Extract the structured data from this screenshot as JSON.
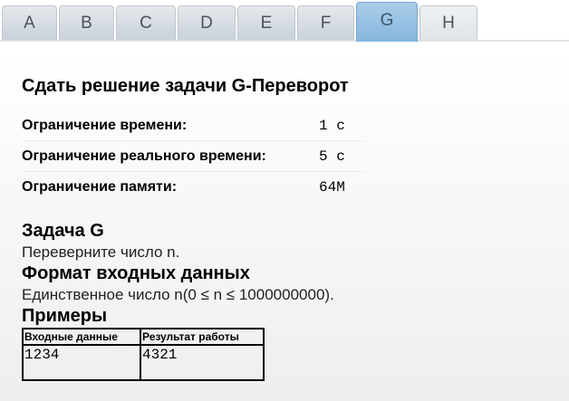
{
  "tabs": [
    {
      "label": "A",
      "active": false
    },
    {
      "label": "B",
      "active": false
    },
    {
      "label": "C",
      "active": false
    },
    {
      "label": "D",
      "active": false
    },
    {
      "label": "E",
      "active": false
    },
    {
      "label": "F",
      "active": false
    },
    {
      "label": "G",
      "active": true
    },
    {
      "label": "H",
      "active": false
    }
  ],
  "page_title": "Сдать решение задачи G-Переворот",
  "limits": [
    {
      "label": "Ограничение времени:",
      "value": "1 с"
    },
    {
      "label": "Ограничение реального времени:",
      "value": "5 с"
    },
    {
      "label": "Ограничение памяти:",
      "value": "64M"
    }
  ],
  "problem": {
    "heading": "Задача G",
    "statement": "Переверните число n.",
    "input_heading": "Формат входных данных",
    "input_text": "Единственное число n(0 ≤ n ≤ 1000000000).",
    "examples_heading": "Примеры",
    "examples_table": {
      "headers": [
        "Входные данные",
        "Результат работы"
      ],
      "rows": [
        [
          "1234",
          "4321"
        ]
      ]
    }
  },
  "colors": {
    "active_tab": "#8fbde2",
    "inactive_tab": "#d3d9df"
  }
}
